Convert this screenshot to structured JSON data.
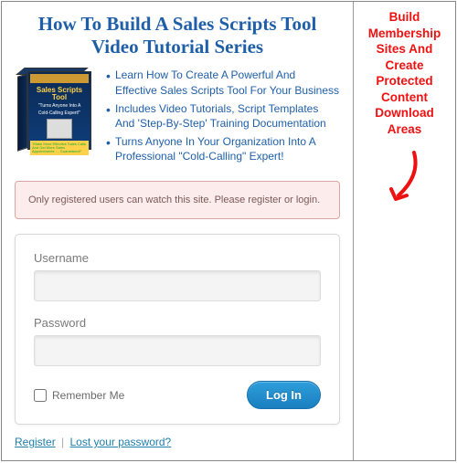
{
  "headline_line1": "How To Build A Sales Scripts Tool",
  "headline_line2": "Video Tutorial Series",
  "boxart": {
    "title": "Sales Scripts Tool",
    "tag1": "\"Turns Anyone Into A",
    "tag2": "Cold-Calling Expert!\"",
    "badge": "\"Make More Effective Sales Calls And Get More Sales Appointments … Guaranteed!\""
  },
  "bullets": [
    "Learn How To Create A Powerful And Effective Sales Scripts Tool For Your Business",
    "Includes Video Tutorials, Script Templates And 'Step-By-Step' Training Documentation",
    "Turns Anyone In Your Organization Into A Professional \"Cold-Calling\" Expert!"
  ],
  "alert": "Only registered users can watch this site. Please register or login.",
  "login": {
    "username_label": "Username",
    "password_label": "Password",
    "remember_label": "Remember Me",
    "submit_label": "Log In"
  },
  "links": {
    "register": "Register",
    "lost": "Lost your password?",
    "sep": "|"
  },
  "callout": {
    "l1": "Build Membership",
    "l2": "Sites And Create",
    "l3": "Protected Content",
    "l4": "Download Areas"
  }
}
